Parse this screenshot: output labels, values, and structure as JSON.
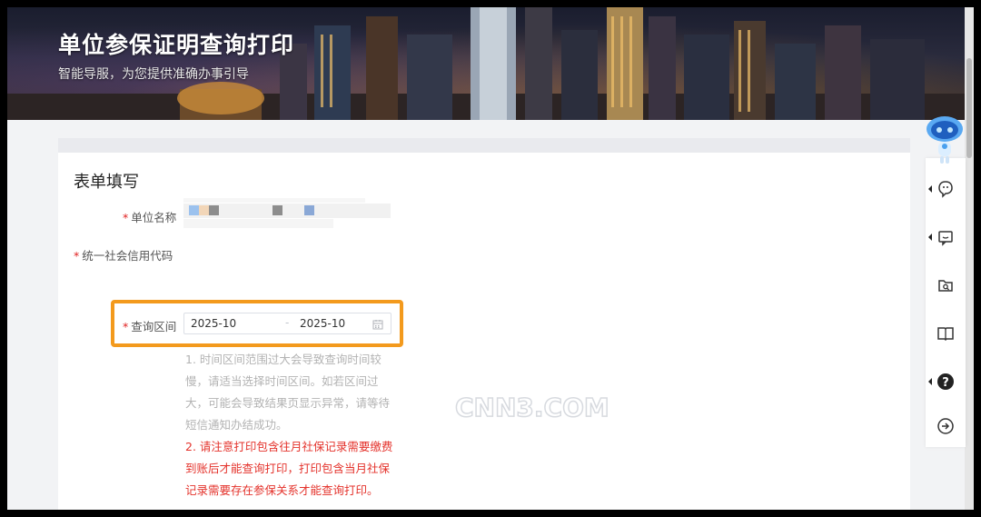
{
  "banner": {
    "title": "单位参保证明查询打印",
    "subtitle": "智能导服，为您提供准确办事引导"
  },
  "form": {
    "title": "表单填写",
    "fields": {
      "company_name": {
        "label": "单位名称",
        "required_mark": "*"
      },
      "credit_code": {
        "label": "统一社会信用代码",
        "required_mark": "*"
      },
      "query_range": {
        "label": "查询区间",
        "required_mark": "*",
        "start": "2025-10",
        "separator": "-",
        "end": "2025-10"
      }
    },
    "notes": {
      "gray": "1. 时间区间范围过大会导致查询时间较慢，请适当选择时间区间。如若区间过大，可能会导致结果页显示异常，请等待短信通知办结成功。",
      "red": "2. 请注意打印包含往月社保记录需要缴费到账后才能查询打印，打印包含当月社保记录需要存在参保关系才能查询打印。"
    }
  },
  "watermark": {
    "text": "CNN3.COM"
  },
  "side_tools": [
    "robot-assistant-icon",
    "chat-icon",
    "message-icon",
    "folder-search-icon",
    "book-icon",
    "help-icon",
    "exit-icon"
  ],
  "colors": {
    "highlight": "#f39a1d",
    "required": "#e02020",
    "note_red": "#e4322b"
  }
}
